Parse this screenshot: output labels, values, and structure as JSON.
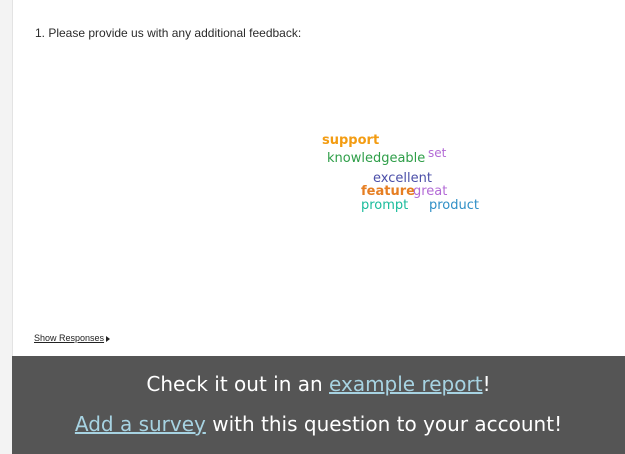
{
  "question": {
    "title": "1. Please provide us with any additional feedback:"
  },
  "word_cloud": {
    "words": [
      {
        "text": "support",
        "color": "#f39c12"
      },
      {
        "text": "knowledgeable",
        "color": "#2e9e48"
      },
      {
        "text": "set",
        "color": "#b36ad6"
      },
      {
        "text": "excellent",
        "color": "#4b4fa8"
      },
      {
        "text": "feature",
        "color": "#e67e22"
      },
      {
        "text": "great",
        "color": "#b36ad6"
      },
      {
        "text": "prompt",
        "color": "#1abc9c"
      },
      {
        "text": "product",
        "color": "#2f8fc6"
      }
    ]
  },
  "show_responses": {
    "label": "Show Responses"
  },
  "cta": {
    "line1_prefix": "Check it out in an ",
    "line1_link": "example report",
    "line1_suffix": "!",
    "line2_link": "Add a survey",
    "line2_suffix": " with this question to your account!",
    "background_color": "#555555",
    "link_color": "#a7d3e2"
  }
}
